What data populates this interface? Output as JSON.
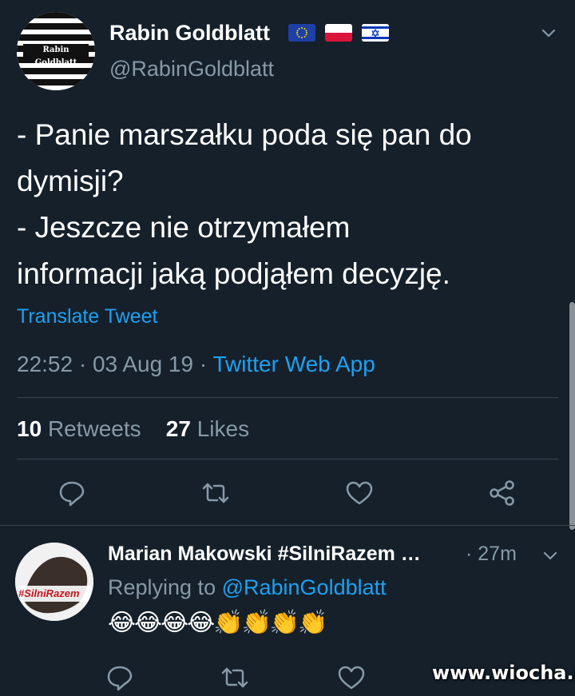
{
  "tweet": {
    "author_name": "Rabin Goldblatt",
    "author_handle": "@RabinGoldblatt",
    "avatar_text": "Rabin Goldblatt",
    "flags": [
      "eu-flag",
      "poland-flag",
      "israel-flag"
    ],
    "text": "- Panie marszałku poda się pan do\ndymisji?\n- Jeszcze nie otrzymałem\ninformacji jaką podjąłem decyzję.",
    "translate_label": "Translate Tweet",
    "timestamp": "22:52 · 03 Aug 19 · ",
    "source": "Twitter Web App",
    "retweets_count": "10",
    "retweets_label": "Retweets",
    "likes_count": "27",
    "likes_label": "Likes"
  },
  "reply": {
    "author_name": "Marian Makowski #SilniRazem …",
    "time": "· 27m",
    "replying_prefix": "Replying to ",
    "replying_to": "@RabinGoldblatt",
    "text": "😂😂😂😂👏👏👏👏",
    "avatar_text": "#SilniRazem"
  },
  "watermark": "www.wiocha.pl",
  "colors": {
    "background": "#15202b",
    "accent": "#1da1f2",
    "secondary_text": "#8899a6",
    "divider": "#38444d"
  }
}
